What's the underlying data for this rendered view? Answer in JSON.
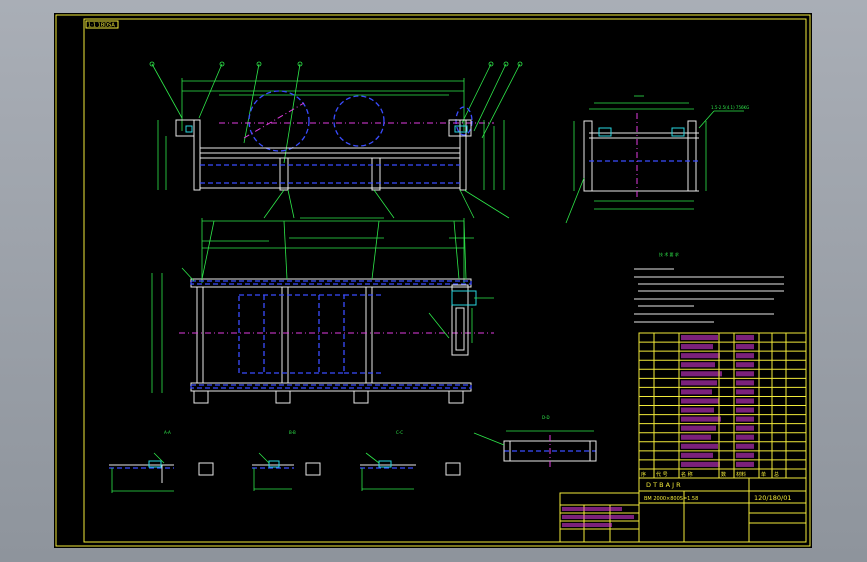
{
  "drawing": {
    "top_tag": "1:1 1BDSA",
    "title_row_left": "D T B A J R",
    "title_row_right": "120/180/01",
    "spec_line": "BM 2000×800S=1.58",
    "section_labels": [
      "A-A",
      "B-B",
      "C-C",
      "D-D"
    ],
    "bom_header": [
      "序",
      "代 号",
      "名 称",
      "数",
      "材料",
      "单",
      "总"
    ],
    "bom_rows": 15,
    "note_title": "技 术 要 求",
    "note_lines": 8,
    "dimension_tag": "1.5-2.5(4.1) 756KG"
  },
  "colors": {
    "background": "#000000",
    "frame": "#f2ea3a",
    "outline": "#e8e8e8",
    "dimension": "#2ee84a",
    "center_line": "#e03ce0",
    "hidden_line": "#3a4cff",
    "accent": "#29d6e0"
  }
}
